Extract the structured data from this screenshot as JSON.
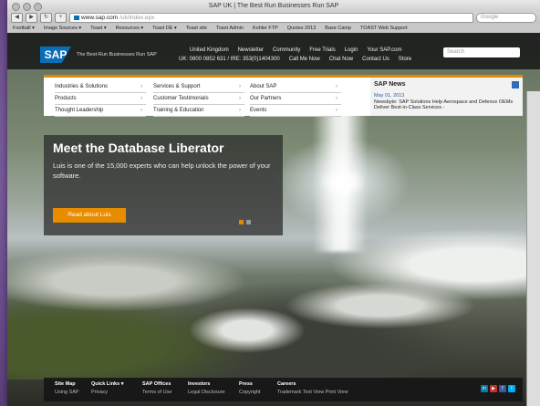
{
  "browser": {
    "title": "SAP UK | The Best Run Businesses Run SAP",
    "url_host": "www.sap.com",
    "url_path": "/uk/index.epx",
    "search_placeholder": "Google",
    "bookmarks": [
      "Football ▾",
      "Image Sources ▾",
      "Toast ▾",
      "Resources ▾",
      "Toast DE ▾",
      "Toast site",
      "Toast Admin",
      "Kohler FTP",
      "Quotes 2013",
      "Base Camp",
      "TOAST Web Support"
    ]
  },
  "header": {
    "logo": "SAP",
    "tagline": "The Best-Run Businesses Run SAP",
    "links1": [
      "United Kingdom",
      "Newsletter",
      "Community",
      "Free Trials",
      "Login",
      "Your SAP.com"
    ],
    "links2": [
      "UK: 0800 0852 631 / IRE: 353(0)1404300",
      "Call Me Now",
      "Chat Now",
      "Contact Us",
      "Store"
    ],
    "search_placeholder": "Search"
  },
  "nav": {
    "col1": [
      "Industries & Solutions",
      "Products",
      "Thought Leadership"
    ],
    "col2": [
      "Services & Support",
      "Customer Testimonials",
      "Training & Education"
    ],
    "col3": [
      "About SAP",
      "Our Partners",
      "Events"
    ]
  },
  "news": {
    "heading": "SAP News",
    "date": "May 01, 2013",
    "text": "Newsbyte: SAP Solutions Help Aerospace and Defence OEMs Deliver Best-in-Class Services -"
  },
  "hero": {
    "title": "Meet the Database Liberator",
    "body": "Luis is one of the 15,000 experts who can help unlock the power of your software.",
    "cta": "Read about Luis"
  },
  "footer": {
    "cols": [
      {
        "title": "Site Map",
        "sub": "Using SAP"
      },
      {
        "title": "Quick Links ▾",
        "sub": "Privacy"
      },
      {
        "title": "SAP Offices",
        "sub": "Terms of Use"
      },
      {
        "title": "Investors",
        "sub": "Legal Disclosure"
      },
      {
        "title": "Press",
        "sub": "Copyright"
      },
      {
        "title": "Careers",
        "sub": "Trademark   Text View   Print View"
      }
    ]
  },
  "colors": {
    "accent": "#e08a00",
    "brand": "#0a6fb6"
  }
}
